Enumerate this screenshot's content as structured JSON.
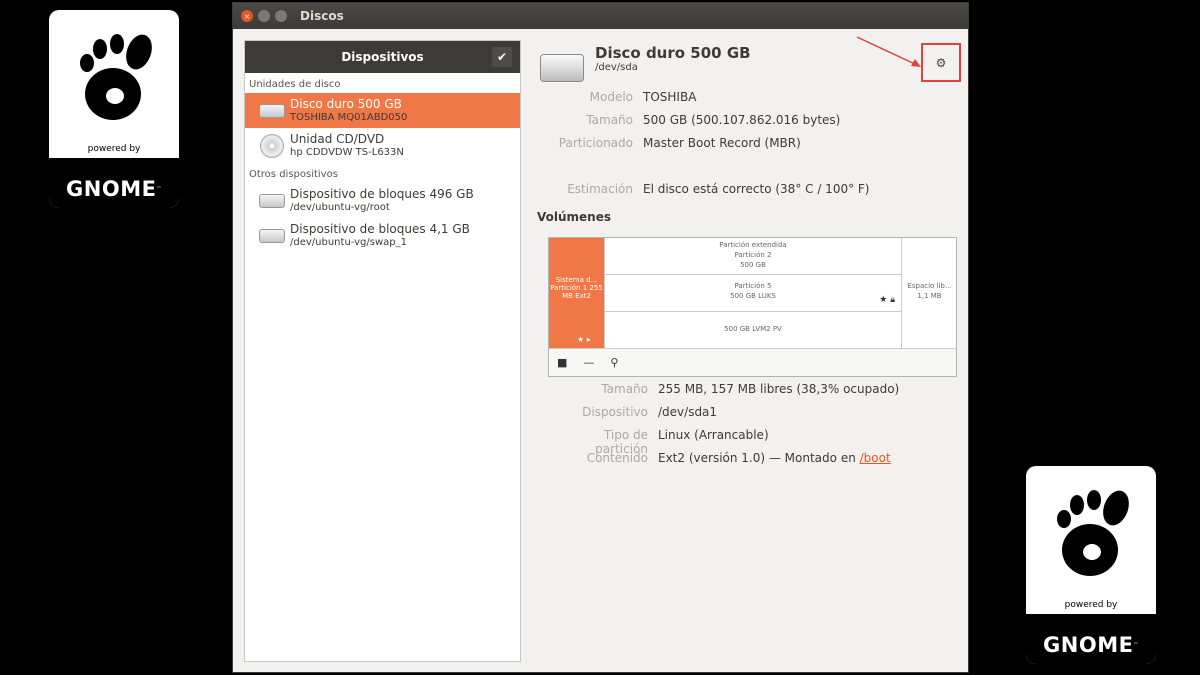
{
  "badge": {
    "powered": "powered by",
    "name": "GNOME",
    "tm": "™"
  },
  "window": {
    "title": "Discos"
  },
  "sidebar": {
    "header": "Dispositivos",
    "section_disks": "Unidades de disco",
    "section_other": "Otros dispositivos",
    "devices": [
      {
        "name": "Disco duro 500 GB",
        "sub": "TOSHIBA MQ01ABD050",
        "icon": "hdd-icon"
      },
      {
        "name": "Unidad CD/DVD",
        "sub": "hp      CDDVDW TS-L633N",
        "icon": "cd-icon"
      }
    ],
    "other_devices": [
      {
        "name": "Dispositivo de bloques 496 GB",
        "sub": "/dev/ubuntu-vg/root",
        "icon": "hdd-icon"
      },
      {
        "name": "Dispositivo de bloques 4,1 GB",
        "sub": "/dev/ubuntu-vg/swap_1",
        "icon": "hdd-icon"
      }
    ]
  },
  "disk": {
    "title": "Disco duro 500 GB",
    "device": "/dev/sda",
    "model_label": "Modelo",
    "model": "TOSHIBA",
    "size_label": "Tamaño",
    "size": "500 GB (500.107.862.016 bytes)",
    "partitioning_label": "Particionado",
    "partitioning": "Master Boot Record (MBR)",
    "assessment_label": "Estimación",
    "assessment": "El disco está correcto (38° C / 100° F)"
  },
  "volumes": {
    "title": "Volúmenes",
    "p1": "Sistema d... Partición 1 255 MB Ext2",
    "extended": [
      "Partición extendida",
      "Partición 2",
      "500 GB"
    ],
    "p5": [
      "Partición 5",
      "500 GB LUKS"
    ],
    "lvm": "500 GB LVM2 PV",
    "free": [
      "Espacio lib...",
      "1,1 MB"
    ]
  },
  "partition": {
    "size_label": "Tamaño",
    "size": "255 MB, 157 MB libres (38,3% ocupado)",
    "device_label": "Dispositivo",
    "device": "/dev/sda1",
    "type_label": "Tipo de partición",
    "type": "Linux (Arrancable)",
    "content_label": "Contenido",
    "content": "Ext2 (versión 1.0) — Montado en ",
    "mount": "/boot"
  }
}
